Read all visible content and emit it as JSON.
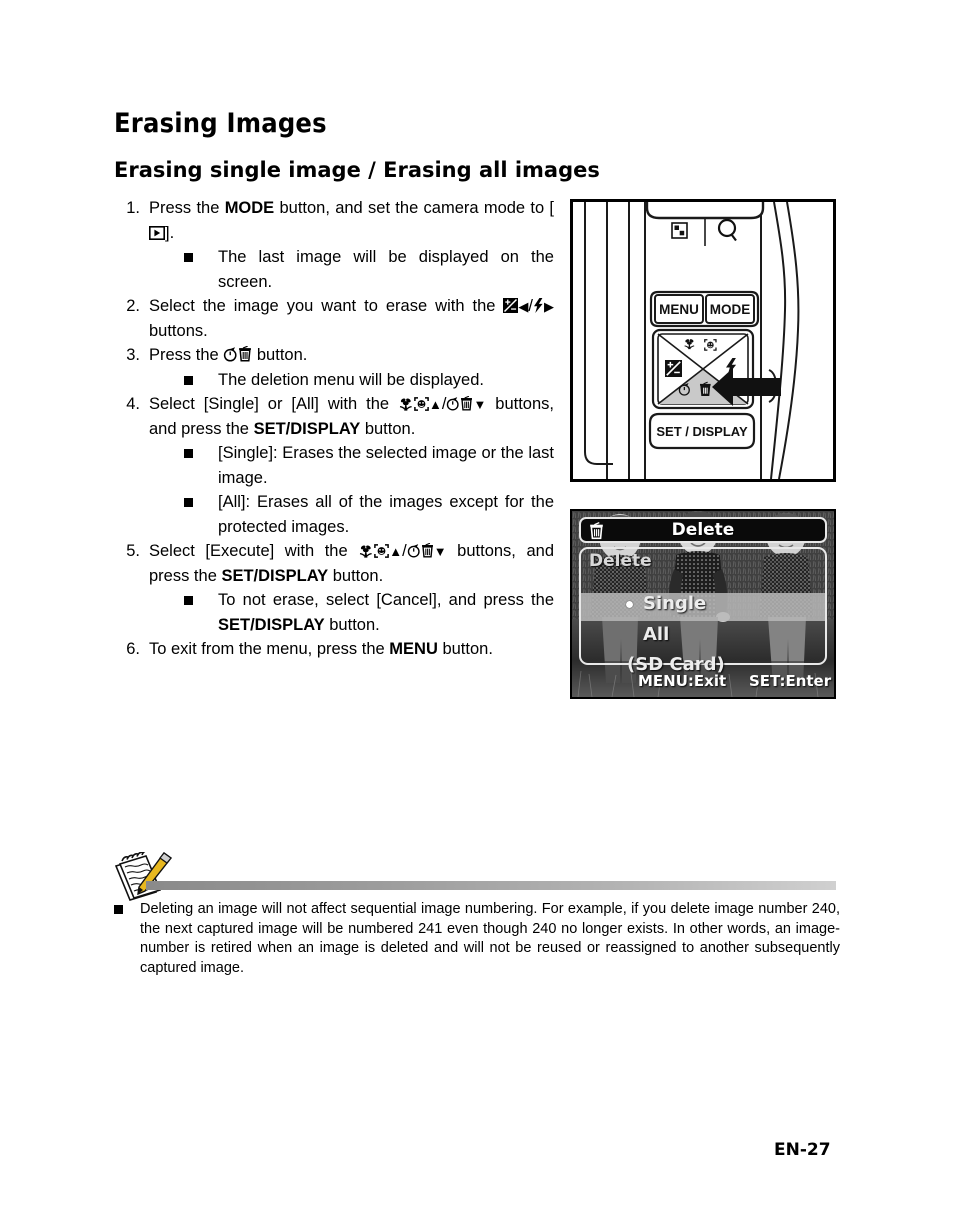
{
  "page": {
    "title": "Erasing Images",
    "subtitle": "Erasing single image / Erasing all images",
    "footer": "EN-27"
  },
  "steps": [
    {
      "num": "1.",
      "text_a": "Press the ",
      "bold_a": "MODE",
      "text_b": " button, and set the camera mode to [",
      "icon": "playback-icon",
      "text_c": "].",
      "subs": [
        {
          "bullet": "square",
          "text": "The last image will be displayed on the screen."
        }
      ]
    },
    {
      "num": "2.",
      "text_a": "Select the image you want to erase with the ",
      "icons": [
        "exposure-compensation-icon",
        "left-triangle-icon",
        "slash",
        "flash-icon",
        "right-triangle-icon"
      ],
      "text_b": " buttons.",
      "subs": []
    },
    {
      "num": "3.",
      "text_a": "Press the ",
      "icons": [
        "self-timer-icon",
        "trash-icon"
      ],
      "text_b": " button.",
      "subs": [
        {
          "bullet": "square",
          "text": "The deletion menu will be displayed."
        }
      ]
    },
    {
      "num": "4.",
      "text_a": "Select [Single] or [All] with the ",
      "icons": [
        "macro-icon",
        "face-detection-icon",
        "up-triangle-icon",
        "slash",
        "self-timer-icon",
        "trash-icon",
        "down-triangle-icon"
      ],
      "text_b": " buttons, and press the ",
      "bold_b": "SET/DISPLAY",
      "text_c": " button.",
      "subs": [
        {
          "bullet": "square",
          "text": "[Single]: Erases the selected image or the last image."
        },
        {
          "bullet": "square",
          "text": "[All]: Erases all of the images except for the protected images."
        }
      ]
    },
    {
      "num": "5.",
      "text_a": "Select [Execute] with the ",
      "icons": [
        "macro-icon",
        "face-detection-icon",
        "up-triangle-icon",
        "slash",
        "self-timer-icon",
        "trash-icon",
        "down-triangle-icon"
      ],
      "text_b": " buttons, and press the ",
      "bold_b": "SET/DISPLAY",
      "text_c": " button.",
      "subs": [
        {
          "bullet": "square",
          "text_a": "To not erase, select [Cancel], and press the ",
          "bold": "SET/DISPLAY",
          "text_b": " button."
        }
      ]
    },
    {
      "num": "6.",
      "text_a": "To exit from the menu, press the ",
      "bold_a": "MENU",
      "text_b": " button.",
      "subs": []
    }
  ],
  "camera_figure": {
    "name": "camera-back-illustration",
    "top_icons": [
      "thumbnail-icon",
      "zoom-magnifier-icon"
    ],
    "buttons": [
      "MENU",
      "MODE"
    ],
    "set_display_label": "SET / DISPLAY",
    "pad_icons": {
      "up": [
        "macro-icon",
        "face-detection-icon"
      ],
      "left": "exposure-compensation-icon",
      "right": "flash-icon",
      "down": [
        "self-timer-icon",
        "trash-icon"
      ]
    },
    "pointer": "arrow-pointing-to-down-button"
  },
  "lcd_figure": {
    "name": "camera-lcd-delete-menu",
    "title_icon": "trash-icon",
    "title": "Delete",
    "panel_label": "Delete",
    "options": [
      {
        "label": "Single",
        "selected": true
      },
      {
        "label": "All",
        "selected": false
      },
      {
        "label": "(SD Card)",
        "selected": false
      }
    ],
    "footer_left": "MENU:Exit",
    "footer_right": "SET:Enter"
  },
  "note": {
    "icon": "notepad-pencil-icon",
    "bullet": "square",
    "text": "Deleting an image will not affect sequential image numbering. For example, if you delete image number 240, the next captured image will be numbered 241 even though 240 no longer exists. In other words, an image-number is retired when an image is deleted and will not be reused or reassigned to another subsequently captured image."
  },
  "colors": {
    "text": "#000000",
    "rule_dark": "#8a8a8a",
    "rule_light": "#d0d0d0",
    "pencil": "#e8b81f",
    "lcd_highlight": "#b9b9b9"
  }
}
